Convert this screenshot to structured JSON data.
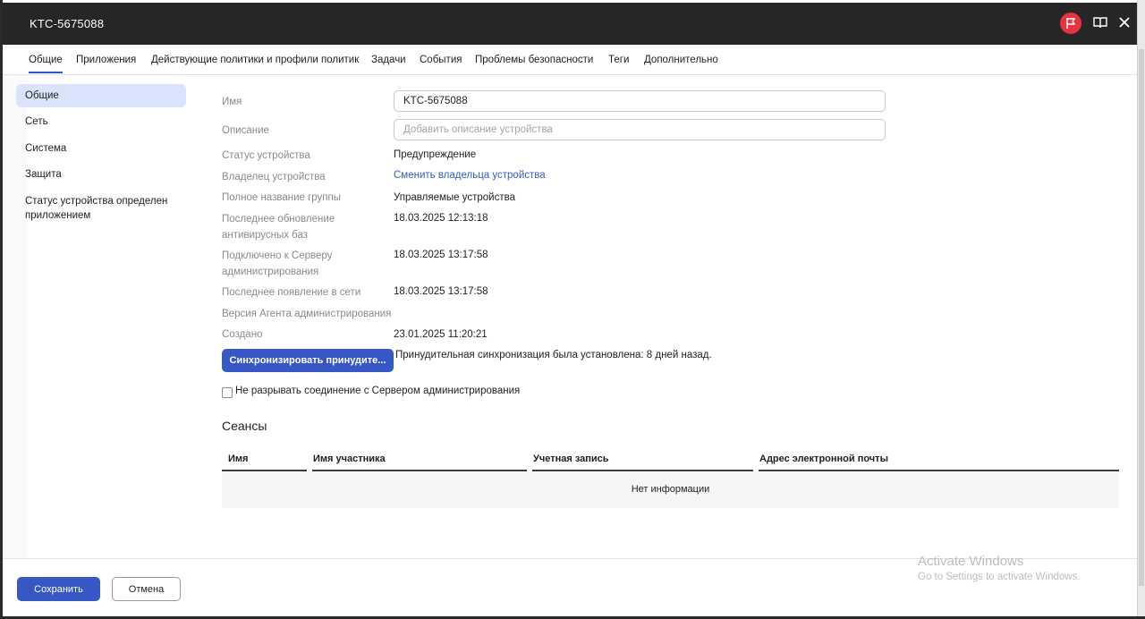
{
  "window": {
    "title": "KTC-5675088"
  },
  "tabs": [
    {
      "label": "Общие",
      "active": true
    },
    {
      "label": "Приложения"
    },
    {
      "label": "Действующие политики и профили политик"
    },
    {
      "label": "Задачи"
    },
    {
      "label": "События"
    },
    {
      "label": "Проблемы безопасности"
    },
    {
      "label": "Теги"
    },
    {
      "label": "Дополнительно"
    }
  ],
  "sidebar": {
    "items": [
      {
        "label": "Общие",
        "active": true
      },
      {
        "label": "Сеть"
      },
      {
        "label": "Система"
      },
      {
        "label": "Защита"
      },
      {
        "label": "Статус устройства определен приложением"
      }
    ]
  },
  "form": {
    "name_label": "Имя",
    "name_value": "KTC-5675088",
    "description_label": "Описание",
    "description_placeholder": "Добавить описание устройства",
    "status_label": "Статус устройства",
    "status_value": "Предупреждение",
    "owner_label": "Владелец устройства",
    "owner_link": "Сменить владельца устройства",
    "group_label": "Полное название группы",
    "group_value": "Управляемые устройства",
    "av_update_label": "Последнее обновление антивирусных баз",
    "av_update_value": "18.03.2025 12:13:18",
    "connected_label": "Подключено к Серверу администрирования",
    "connected_value": "18.03.2025 13:17:58",
    "last_seen_label": "Последнее появление в сети",
    "last_seen_value": "18.03.2025 13:17:58",
    "agent_version_label": "Версия Агента администрирования",
    "created_label": "Создано",
    "created_value": "23.01.2025 11:20:21",
    "sync_button": "Синхронизировать принудите...",
    "sync_note": "Принудительная синхронизация была установлена: 8 дней назад.",
    "keep_connection_label": "Не разрывать соединение с Сервером администрирования",
    "keep_connection_checked": false
  },
  "sessions": {
    "title": "Сеансы",
    "columns": [
      "Имя",
      "Имя участника",
      "Учетная запись",
      "Адрес электронной почты"
    ],
    "empty_text": "Нет информации"
  },
  "footer": {
    "save_label": "Сохранить",
    "cancel_label": "Отмена"
  },
  "watermark": {
    "line1": "Activate Windows",
    "line2": "Go to Settings to activate Windows."
  },
  "colors": {
    "titlebar": "#262626",
    "accent": "#3657c4",
    "link": "#2f5fbf",
    "flag": "#e3343f",
    "sidebar_active": "#d9e3fb"
  },
  "icons": [
    "flag-icon",
    "book-icon",
    "close-icon"
  ]
}
